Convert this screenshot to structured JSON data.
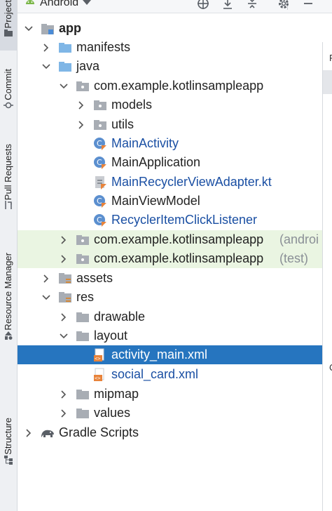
{
  "left_strip": {
    "tabs": [
      "Project",
      "Commit",
      "Pull Requests",
      "Resource Manager",
      "Structure"
    ]
  },
  "toolbar": {
    "view_label": "Android",
    "icons": [
      "crosshair-icon",
      "expand-all-icon",
      "collapse-all-icon",
      "gear-icon",
      "minimize-icon"
    ]
  },
  "tree": {
    "app": "app",
    "manifests": "manifests",
    "java": "java",
    "pkg_main": "com.example.kotlinsampleapp",
    "models": "models",
    "utils": "utils",
    "main_activity": "MainActivity",
    "main_application": "MainApplication",
    "main_recycler_adapter": "MainRecyclerViewAdapter.kt",
    "main_view_model": "MainViewModel",
    "recycler_listener": "RecyclerItemClickListener",
    "pkg_android_test": "com.example.kotlinsampleapp",
    "pkg_android_test_suffix": "(androi",
    "pkg_test": "com.example.kotlinsampleapp",
    "pkg_test_suffix": "(test)",
    "assets": "assets",
    "res": "res",
    "drawable": "drawable",
    "layout": "layout",
    "activity_main": "activity_main.xml",
    "social_card": "social_card.xml",
    "mipmap": "mipmap",
    "values": "values",
    "gradle_scripts": "Gradle Scripts"
  },
  "editor_stub": {
    "letter1": "P",
    "letter2": "C"
  },
  "colors": {
    "selection": "#2675bf",
    "highlight": "#eaf5e2",
    "link_blue": "#1a4fa3",
    "kotlin_orange": "#e8833a"
  }
}
